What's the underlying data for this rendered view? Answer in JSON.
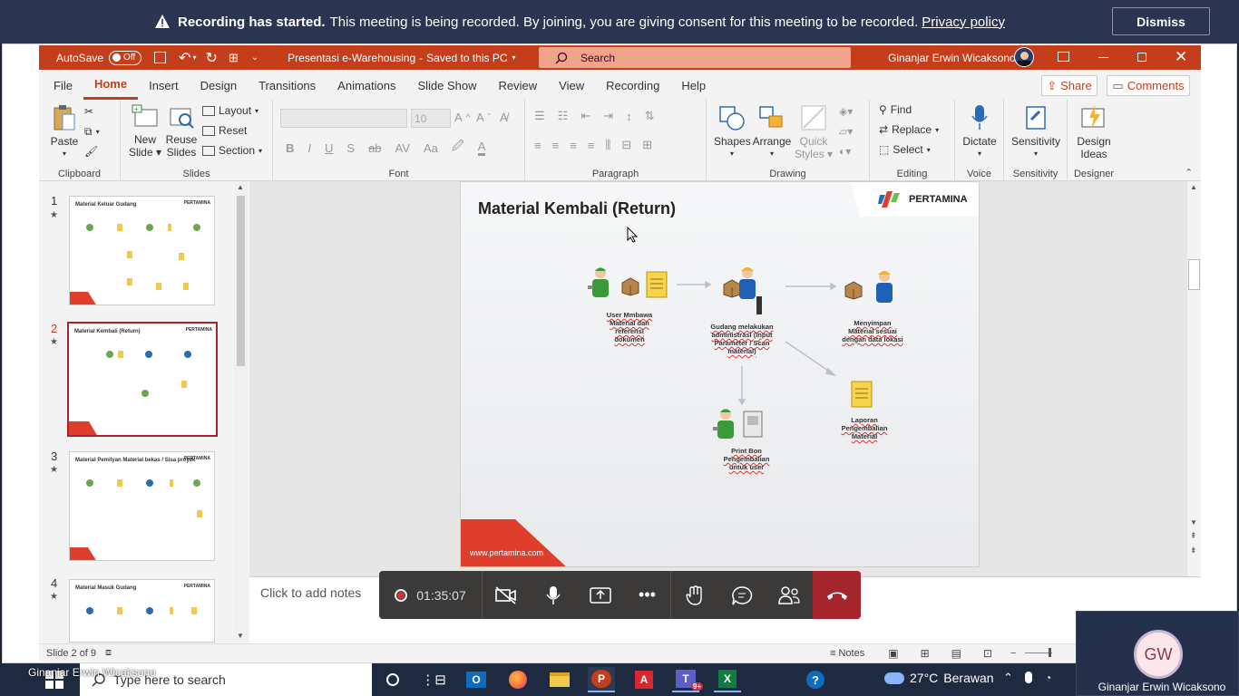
{
  "banner": {
    "title": "Recording has started.",
    "message": "This meeting is being recorded. By joining, you are giving consent for this meeting to be recorded.",
    "link": "Privacy policy",
    "dismiss": "Dismiss"
  },
  "titlebar": {
    "autosave": "AutoSave",
    "autosave_state": "Off",
    "filename": "Presentasi e-Warehousing",
    "saved": "Saved to this PC",
    "search_placeholder": "Search",
    "user": "Ginanjar Erwin Wicaksono"
  },
  "tabs": [
    "File",
    "Home",
    "Insert",
    "Design",
    "Transitions",
    "Animations",
    "Slide Show",
    "Review",
    "View",
    "Recording",
    "Help"
  ],
  "share": "Share",
  "comments": "Comments",
  "ribbon": {
    "clipboard": {
      "label": "Clipboard",
      "paste": "Paste"
    },
    "slides": {
      "label": "Slides",
      "new_slide": "New",
      "new_slide2": "Slide",
      "reuse": "Reuse",
      "reuse2": "Slides",
      "layout": "Layout",
      "reset": "Reset",
      "section": "Section"
    },
    "font": {
      "label": "Font",
      "size": "10"
    },
    "paragraph": {
      "label": "Paragraph"
    },
    "drawing": {
      "label": "Drawing",
      "shapes": "Shapes",
      "arrange": "Arrange",
      "quick": "Quick",
      "styles": "Styles"
    },
    "editing": {
      "label": "Editing",
      "find": "Find",
      "replace": "Replace",
      "select": "Select"
    },
    "voice": {
      "label": "Voice",
      "dictate": "Dictate"
    },
    "sensitivity": {
      "label": "Sensitivity",
      "btn": "Sensitivity"
    },
    "designer": {
      "label": "Designer",
      "btn": "Design",
      "btn2": "Ideas"
    }
  },
  "thumbnails": [
    {
      "num": "1",
      "title": "Material Keluar Gudang"
    },
    {
      "num": "2",
      "title": "Material Kembali (Return)"
    },
    {
      "num": "3",
      "title": "Material Pemilyan Material bekas / Sisa proyek"
    },
    {
      "num": "4",
      "title": "Material Masuk Gudang"
    }
  ],
  "thumb_brand": "PERTAMINA",
  "slide": {
    "title": "Material Kembali (Return)",
    "brand": "PERTAMINA",
    "url": "www.pertamina.com",
    "step1": [
      "User Mmbawa",
      "Material dan",
      "referensi",
      "dokumen"
    ],
    "step2": [
      "Gudang melakukan",
      "administrasi (input",
      "Parameter / Scan",
      "material)"
    ],
    "step3": [
      "Menyimpan",
      "Material sesuai",
      "dengan data lokasi"
    ],
    "step4": [
      "Laporan",
      "Pengembalian",
      "Material"
    ],
    "step5": [
      "Print Bon",
      "Pengembalian",
      "untuk user"
    ]
  },
  "notes_placeholder": "Click to add notes",
  "status": {
    "slide_info": "Slide 2 of 9",
    "notes": "Notes"
  },
  "call": {
    "timer": "01:35:07"
  },
  "taskbar": {
    "search_placeholder": "Type here to search",
    "weather_temp": "27°C",
    "weather_desc": "Berawan",
    "teams_badge": "9+"
  },
  "presenter_caption": "Ginanjar Erwin Wicaksono",
  "tile": {
    "initials": "GW",
    "name": "Ginanjar Erwin Wicaksono"
  },
  "colors": {
    "accent": "#c43e1c",
    "banner": "#2b3552",
    "call_end": "#a4262c",
    "taskbar": "#1e2a3f"
  }
}
